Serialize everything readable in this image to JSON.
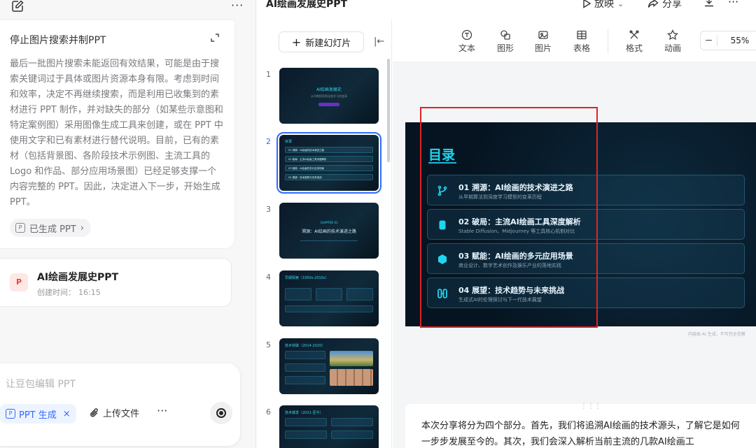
{
  "left": {
    "thinking": {
      "title": "停止图片搜索并制PPT",
      "body": "最后一批图片搜索未能返回有效结果，可能是由于搜索关键词过于具体或图片资源本身有限。考虑到时间和效率，决定不再继续搜索，而是利用已收集到的素材进行 PPT 制作，并对缺失的部分（如某些示意图和特定案例图）采用图像生成工具来创建，或在 PPT 中使用文字和已有素材进行替代说明。目前，已有的素材（包括背景图、各阶段技术示例图、主流工具的 Logo 和作品、部分应用场景图）已经足够支撑一个内容完整的 PPT。因此，决定进入下一步，开始生成 PPT。",
      "chip": "已生成 PPT"
    },
    "card": {
      "icon": "P",
      "title": "AI绘画发展史PPT",
      "time_label": "创建时间：",
      "time": "16:15"
    },
    "composer": {
      "placeholder": "让豆包编辑 PPT",
      "chip": "PPT 生成",
      "chip_close": "×",
      "upload": "上传文件",
      "more": "···"
    }
  },
  "header": {
    "title": "AI绘画发展史PPT",
    "play": "放映",
    "share": "分享"
  },
  "thumbs": {
    "new_slide": "新建幻灯片",
    "items": [
      {
        "num": "1",
        "title": "AI绘画发展史",
        "sub": "从早期探索到深度学习的变革"
      },
      {
        "num": "2",
        "title": "目录",
        "lines": [
          "01 溯源：AI绘画的技术演进之路",
          "02 破局：主流AI绘画工具深度解析",
          "03 赋能：AI绘画的多元应用场景",
          "04 展望：技术趋势与未来挑战"
        ]
      },
      {
        "num": "3",
        "kicker": "CHAPTER 01",
        "title": "溯源：AI绘画的技术演进之路"
      },
      {
        "num": "4",
        "title": "早期探索（1950s-2010s）"
      },
      {
        "num": "5",
        "title": "技术突破（2014-2020）"
      },
      {
        "num": "6",
        "title": "技术爆发（2021-至今）"
      }
    ]
  },
  "toolbar": {
    "items": [
      "文本",
      "图形",
      "图片",
      "表格",
      "格式",
      "动画"
    ],
    "zoom": "55%",
    "zoom_minus": "−"
  },
  "slide": {
    "title": "目录",
    "items": [
      {
        "title": "01 溯源：AI绘画的技术演进之路",
        "sub": "从早期算法到深度学习模型的变革历程",
        "icon": "branch-icon"
      },
      {
        "title": "02 破局：主流AI绘画工具深度解析",
        "sub": "Stable Diffusion、Midjourney 等工具核心机制对比",
        "icon": "cylinder-icon"
      },
      {
        "title": "03 赋能：AI绘画的多元应用场景",
        "sub": "商业设计、数字艺术创作及娱乐产业的落地实践",
        "icon": "hexagon-icon"
      },
      {
        "title": "04 展望：技术趋势与未来挑战",
        "sub": "生成式AI的伦理探讨与下一代技术展望",
        "icon": "link-icon"
      }
    ],
    "watermark": "内容由 AI 生成，不可完全信赖"
  },
  "notes": {
    "text": "本次分享将分为四个部分。首先，我们将追溯AI绘画的技术源头，了解它是如何一步步发展至今的。其次，我们会深入解析当前主流的几款AI绘画工"
  },
  "colors": {
    "accent": "#2f6bff",
    "cyan": "#1fd6ee",
    "highlight": "#e02424"
  }
}
